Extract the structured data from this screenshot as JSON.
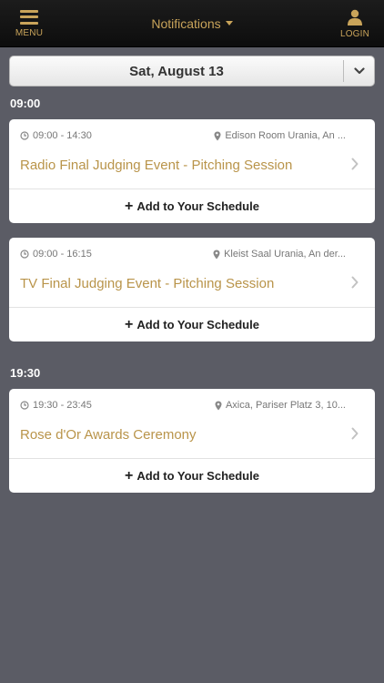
{
  "topbar": {
    "menu_label": "MENU",
    "title": "Notifications",
    "login_label": "LOGIN"
  },
  "date_selector": {
    "label": "Sat, August 13"
  },
  "groups": [
    {
      "time": "09:00",
      "events": [
        {
          "time_range": "09:00 - 14:30",
          "location": "Edison Room Urania, An ...",
          "title": "Radio Final Judging Event - Pitching Session",
          "action": "Add to Your Schedule"
        },
        {
          "time_range": "09:00 - 16:15",
          "location": "Kleist Saal Urania, An der...",
          "title": "TV Final Judging Event - Pitching Session",
          "action": "Add to Your Schedule"
        }
      ]
    },
    {
      "time": "19:30",
      "events": [
        {
          "time_range": "19:30 - 23:45",
          "location": "Axica, Pariser Platz 3, 10...",
          "title": "Rose d'Or Awards Ceremony",
          "action": "Add to Your Schedule"
        }
      ]
    }
  ],
  "colors": {
    "accent": "#c9a45a",
    "title_gold": "#b9944a",
    "background": "#5b5c65",
    "topbar": "#111111"
  },
  "icons": [
    "hamburger-menu-icon",
    "user-icon",
    "caret-down-icon",
    "chevron-down-icon",
    "clock-icon",
    "map-pin-icon",
    "chevron-right-icon",
    "plus-icon"
  ]
}
